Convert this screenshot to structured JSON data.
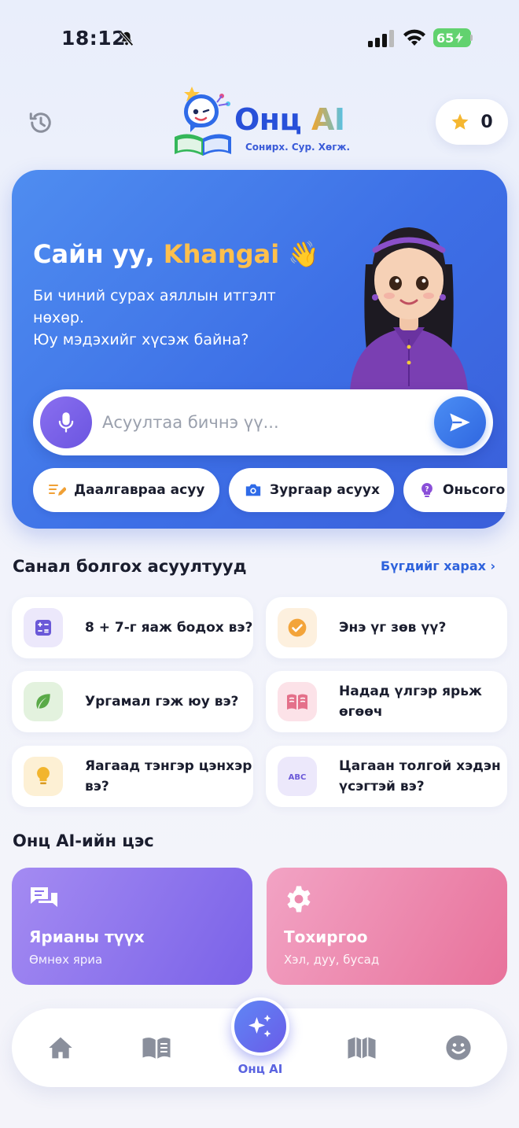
{
  "status_bar": {
    "time": "18:12",
    "battery": "65"
  },
  "header": {
    "logo_title": "Онц",
    "logo_title_ai": "AI",
    "logo_tagline": "Сонирх. Сур. Хөгж.",
    "stars_count": "0"
  },
  "hero": {
    "greeting_prefix": "Сайн уу,",
    "user_name": "Khangai",
    "wave_emoji": "👋",
    "description_line1": "Би чиний сурах аяллын итгэлт",
    "description_line2": "нөхөр.",
    "description_line3": "Юу мэдэхийг хүсэж байна?",
    "input_placeholder": "Асуултаа бичнэ үү...",
    "chips": [
      {
        "label": "Даалгавраа асуу",
        "icon": "pencil-list-icon"
      },
      {
        "label": "Зургаар асуух",
        "icon": "camera-icon"
      },
      {
        "label": "Оньсого",
        "icon": "question-bulb-icon"
      }
    ]
  },
  "suggested": {
    "title": "Санал болгох асуултууд",
    "see_all": "Бүгдийг харах ›",
    "questions": [
      {
        "text": "8 + 7-г яаж бодох вэ?",
        "icon": "calculator-icon"
      },
      {
        "text": "Энэ үг зөв үү?",
        "icon": "check-circle-icon"
      },
      {
        "text": "Ургамал гэж юу вэ?",
        "icon": "leaf-icon"
      },
      {
        "text": "Надад үлгэр ярьж өгөөч",
        "icon": "open-book-icon"
      },
      {
        "text": "Яагаад тэнгэр цэнхэр вэ?",
        "icon": "lightbulb-icon"
      },
      {
        "text": "Цагаан толгой хэдэн үсэгтэй вэ?",
        "icon": "abc-icon"
      }
    ]
  },
  "menu": {
    "title": "Онц AI-ийн цэс",
    "items": [
      {
        "title": "Ярианы түүх",
        "subtitle": "Өмнөх яриа",
        "icon": "chat-bubbles-icon"
      },
      {
        "title": "Тохиргоо",
        "subtitle": "Хэл, дуу, бусад",
        "icon": "gear-icon"
      }
    ]
  },
  "bottom_nav": {
    "center_label": "Онц AI",
    "items": [
      "home-icon",
      "book-icon",
      "sparkles-icon",
      "map-book-icon",
      "smiley-icon"
    ]
  },
  "colors": {
    "brand_blue": "#2850d9",
    "hero_gradient_start": "#4f8df0",
    "hero_gradient_end": "#3a5fda",
    "accent_orange": "#ffc04d",
    "link_blue": "#2e62dc",
    "menu_purple": "#7a62e8",
    "menu_pink": "#e8729b"
  }
}
